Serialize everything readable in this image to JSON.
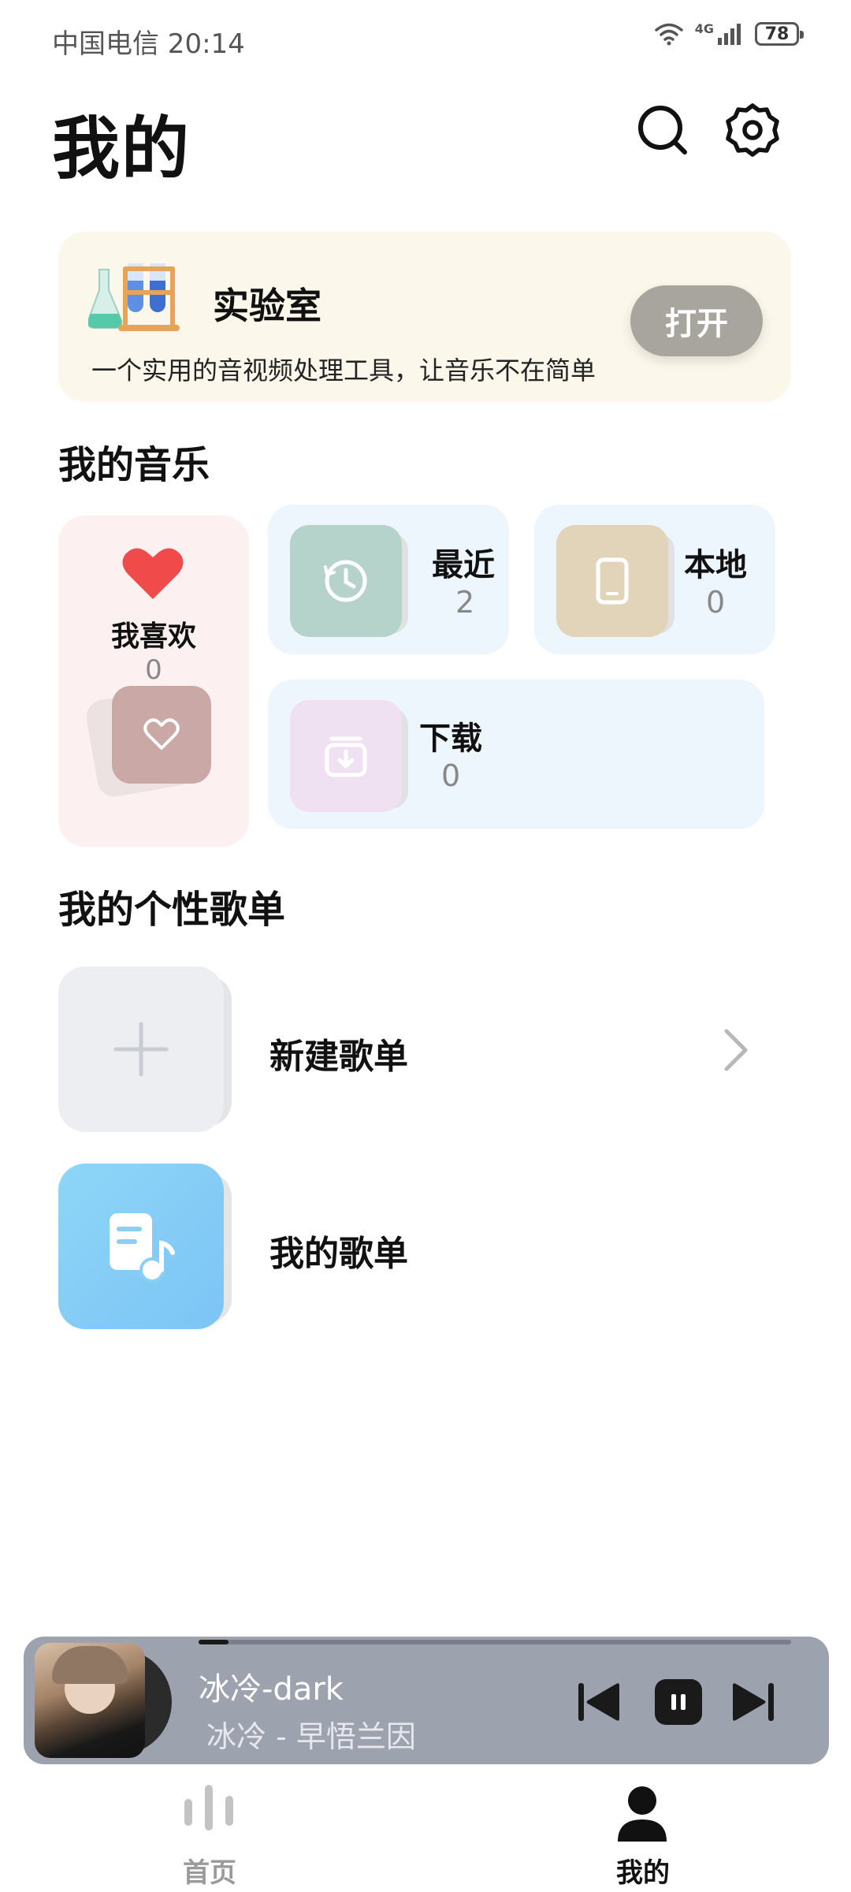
{
  "status_bar": {
    "carrier_time": "中国电信 20:14",
    "network": "4G",
    "battery": "78"
  },
  "header": {
    "title": "我的",
    "icons": [
      "search-icon",
      "settings-icon"
    ]
  },
  "lab": {
    "title": "实验室",
    "description": "一个实用的音视频处理工具，让音乐不在简单",
    "open_label": "打开",
    "icon": "flask-icon"
  },
  "my_music": {
    "title": "我的音乐",
    "favorites": {
      "label": "我喜欢",
      "count": "0",
      "icon": "heart-icon"
    },
    "recent": {
      "label": "最近",
      "count": "2",
      "icon": "clock-icon"
    },
    "local": {
      "label": "本地",
      "count": "0",
      "icon": "phone-icon"
    },
    "downloads": {
      "label": "下载",
      "count": "0",
      "icon": "download-box-icon"
    }
  },
  "playlists": {
    "title": "我的个性歌单",
    "items": [
      {
        "label": "新建歌单",
        "icon": "plus-icon"
      },
      {
        "label": "我的歌单",
        "icon": "music-note-icon"
      }
    ]
  },
  "player": {
    "song_title": "冰冷-dark",
    "artist_album": "冰冷 - 早悟兰因",
    "progress": 0.05,
    "controls": [
      "previous-icon",
      "pause-icon",
      "next-icon"
    ]
  },
  "bottom_nav": {
    "items": [
      {
        "label": "首页",
        "icon": "equalizer-icon",
        "active": false
      },
      {
        "label": "我的",
        "icon": "person-icon",
        "active": true
      }
    ]
  },
  "colors": {
    "lab_bg": "#fbf7ea",
    "favorites_bg": "#fdf0f1",
    "tile_bg": "#eef6fd",
    "heart": "#f04a4a",
    "player_bg": "#9da2af"
  }
}
